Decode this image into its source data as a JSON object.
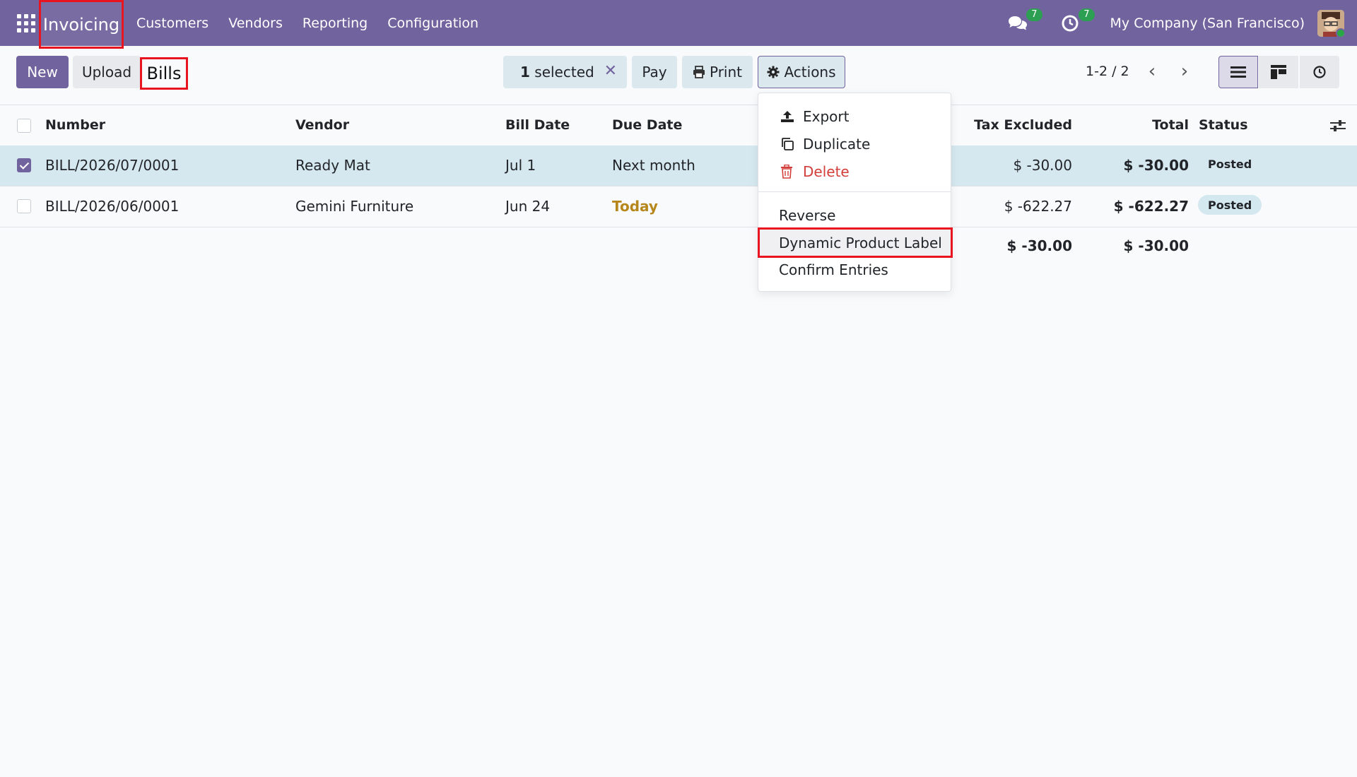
{
  "navbar": {
    "app_name": "Invoicing",
    "menu": [
      "Customers",
      "Vendors",
      "Reporting",
      "Configuration"
    ],
    "messages_count": "7",
    "activities_count": "7",
    "company": "My Company (San Francisco)"
  },
  "control_panel": {
    "new_label": "New",
    "upload_label": "Upload",
    "title": "Bills",
    "selected_count": "1",
    "selected_suffix": " selected",
    "pay_label": "Pay",
    "print_label": "Print",
    "actions_label": "Actions",
    "pager": "1-2 / 2"
  },
  "table": {
    "headers": {
      "number": "Number",
      "vendor": "Vendor",
      "bill_date": "Bill Date",
      "due_date": "Due Date",
      "tax_excluded": "Tax Excluded",
      "total": "Total",
      "status": "Status"
    },
    "rows": [
      {
        "number": "BILL/2026/07/0001",
        "vendor": "Ready Mat",
        "bill_date": "Jul 1",
        "due_date": "Next month",
        "tax_excluded": "$ -30.00",
        "total": "$ -30.00",
        "status": "Posted",
        "checked": true
      },
      {
        "number": "BILL/2026/06/0001",
        "vendor": "Gemini Furniture",
        "bill_date": "Jun 24",
        "due_date": "Today",
        "tax_excluded": "$ -622.27",
        "total": "$ -622.27",
        "status": "Posted",
        "checked": false
      }
    ],
    "totals": {
      "tax_excluded": "$ -30.00",
      "total": "$ -30.00"
    }
  },
  "actions_menu": {
    "export": "Export",
    "duplicate": "Duplicate",
    "delete": "Delete",
    "reverse": "Reverse",
    "dynamic_product_label": "Dynamic Product Label",
    "confirm_entries": "Confirm Entries"
  },
  "colors": {
    "brand": "#71639e",
    "highlight_box": "#e8141f",
    "today": "#b6871c",
    "delete": "#d23f3a"
  },
  "icons": [
    "apps-icon",
    "chat-icon",
    "clock-icon",
    "print-icon",
    "gear-icon",
    "close-icon",
    "chevron-left-icon",
    "chevron-right-icon",
    "list-view-icon",
    "kanban-view-icon",
    "activity-view-icon",
    "optional-columns-icon",
    "upload-icon",
    "copy-icon",
    "trash-icon"
  ]
}
